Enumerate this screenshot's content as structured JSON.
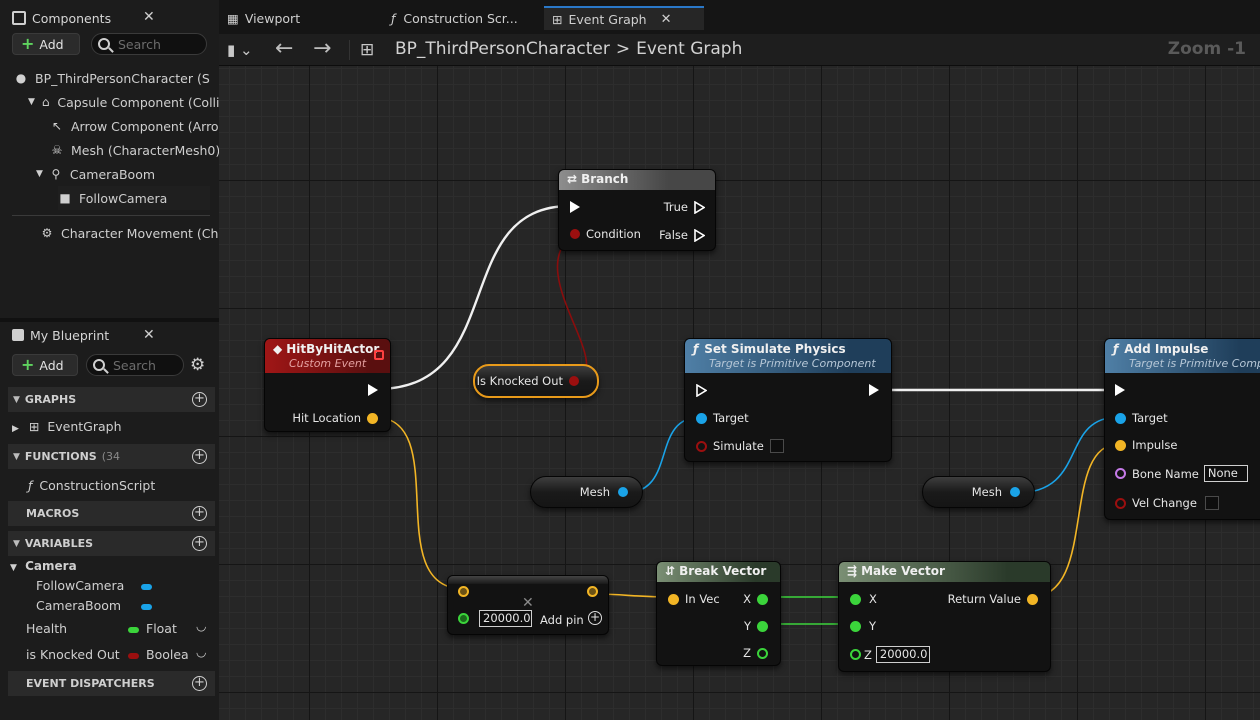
{
  "components_panel": {
    "title": "Components",
    "add_label": "Add",
    "search_placeholder": "Search",
    "tree": [
      {
        "label": "BP_ThirdPersonCharacter (S",
        "icon": "person-icon"
      },
      {
        "label": "Capsule Component (Collis",
        "icon": "capsule-icon"
      },
      {
        "label": "Arrow Component (Arrov",
        "icon": "arrow-icon"
      },
      {
        "label": "Mesh (CharacterMesh0)",
        "icon": "skeleton-icon"
      },
      {
        "label": "CameraBoom",
        "icon": "spring-arm-icon"
      },
      {
        "label": "FollowCamera",
        "icon": "camera-icon"
      },
      {
        "label": "Character Movement (Cha",
        "icon": "movement-icon"
      }
    ]
  },
  "my_blueprint": {
    "title": "My Blueprint",
    "add_label": "Add",
    "search_placeholder": "Search",
    "sections": {
      "graphs": "GRAPHS",
      "functions": "FUNCTIONS",
      "functions_count": "(34",
      "macros": "MACROS",
      "variables": "VARIABLES",
      "event_dispatchers": "EVENT DISPATCHERS"
    },
    "graph_item": "EventGraph",
    "function_item": "ConstructionScript",
    "category": "Camera",
    "variables": [
      {
        "name": "FollowCamera",
        "type": "",
        "color": "#1aa3e8"
      },
      {
        "name": "CameraBoom",
        "type": "",
        "color": "#1aa3e8"
      },
      {
        "name": "Health",
        "type": "Float",
        "color": "#3bd43b"
      },
      {
        "name": "is Knocked Out",
        "type": "Boolear",
        "color": "#9b0f0f"
      }
    ]
  },
  "tabs": [
    {
      "label": "Viewport",
      "icon": "viewport-icon"
    },
    {
      "label": "Construction Scr...",
      "icon": "function-icon"
    },
    {
      "label": "Event Graph",
      "icon": "graph-icon"
    }
  ],
  "toolbar": {
    "breadcrumb_root": "BP_ThirdPersonCharacter",
    "breadcrumb_sep": ">",
    "breadcrumb_current": "Event Graph",
    "zoom": "Zoom -1"
  },
  "nodes": {
    "branch": {
      "title": "Branch",
      "pin_true": "True",
      "pin_false": "False",
      "pin_condition": "Condition"
    },
    "event": {
      "title": "HitByHitActor",
      "subtitle": "Custom Event",
      "pin_hit": "Hit Location"
    },
    "knocked": {
      "label": "Is Knocked Out"
    },
    "simulate": {
      "title": "Set Simulate Physics",
      "subtitle": "Target is Primitive Component",
      "pin_target": "Target",
      "pin_simulate": "Simulate"
    },
    "impulse": {
      "title": "Add Impulse",
      "subtitle": "Target is Primitive Comp",
      "pin_target": "Target",
      "pin_impulse": "Impulse",
      "pin_bone": "Bone Name",
      "bone_value": "None",
      "pin_vel": "Vel Change"
    },
    "mesh1": {
      "label": "Mesh"
    },
    "mesh2": {
      "label": "Mesh"
    },
    "multiply": {
      "value": "20000.0",
      "add_pin": "Add pin"
    },
    "break": {
      "title": "Break Vector",
      "pin_in": "In Vec",
      "pin_x": "X",
      "pin_y": "Y",
      "pin_z": "Z"
    },
    "make": {
      "title": "Make Vector",
      "pin_x": "X",
      "pin_y": "Y",
      "pin_z": "Z",
      "z_value": "20000.0",
      "pin_return": "Return Value"
    }
  }
}
